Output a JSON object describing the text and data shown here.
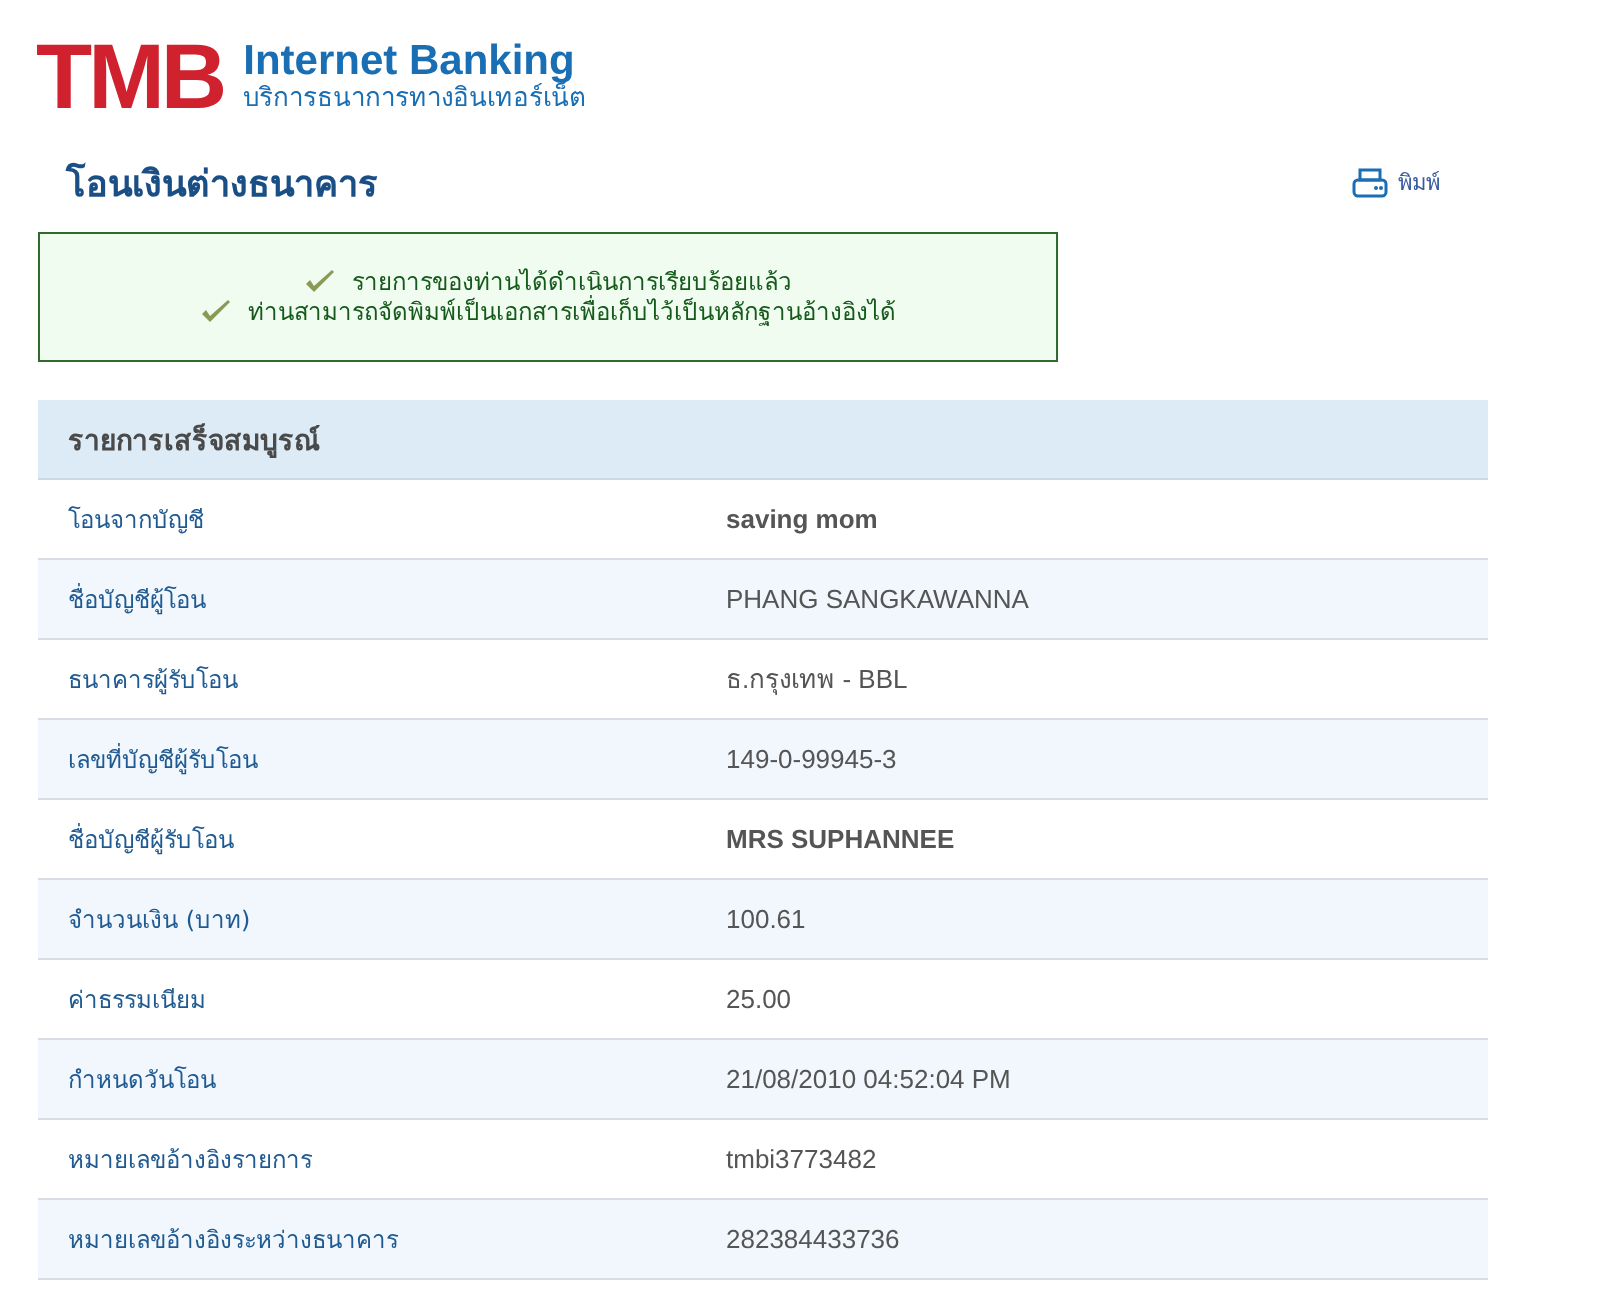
{
  "header": {
    "logo": "TMB",
    "product": "Internet Banking",
    "tagline": "บริการธนาการทางอินเทอร์เน็ต"
  },
  "page_title": "โอนเงินต่างธนาคาร",
  "print_link": "พิมพ์",
  "messages": [
    "รายการของท่านได้ดำเนินการเรียบร้อยแล้ว",
    "ท่านสามารถจัดพิมพ์เป็นเอกสารเพื่อเก็บไว้เป็นหลักฐานอ้างอิงได้"
  ],
  "table": {
    "heading": "รายการเสร็จสมบูรณ์",
    "rows": [
      {
        "label": "โอนจากบัญชี",
        "value": "saving mom",
        "bold": true
      },
      {
        "label": "ชื่อบัญชีผู้โอน",
        "value": "PHANG SANGKAWANNA",
        "bold": false
      },
      {
        "label": "ธนาคารผู้รับโอน",
        "value": "ธ.กรุงเทพ - BBL",
        "bold": false
      },
      {
        "label": "เลขที่บัญชีผู้รับโอน",
        "value": "149-0-99945-3",
        "bold": false
      },
      {
        "label": "ชื่อบัญชีผู้รับโอน",
        "value": "MRS SUPHANNEE",
        "bold": true
      },
      {
        "label": "จำนวนเงิน (บาท)",
        "value": "100.61",
        "bold": false
      },
      {
        "label": "ค่าธรรมเนียม",
        "value": "25.00",
        "bold": false
      },
      {
        "label": "กำหนดวันโอน",
        "value": "21/08/2010 04:52:04 PM",
        "bold": false
      },
      {
        "label": "หมายเลขอ้างอิงรายการ",
        "value": "tmbi3773482",
        "bold": false
      },
      {
        "label": "หมายเลขอ้างอิงระหว่างธนาคาร",
        "value": "282384433736",
        "bold": false
      }
    ]
  }
}
